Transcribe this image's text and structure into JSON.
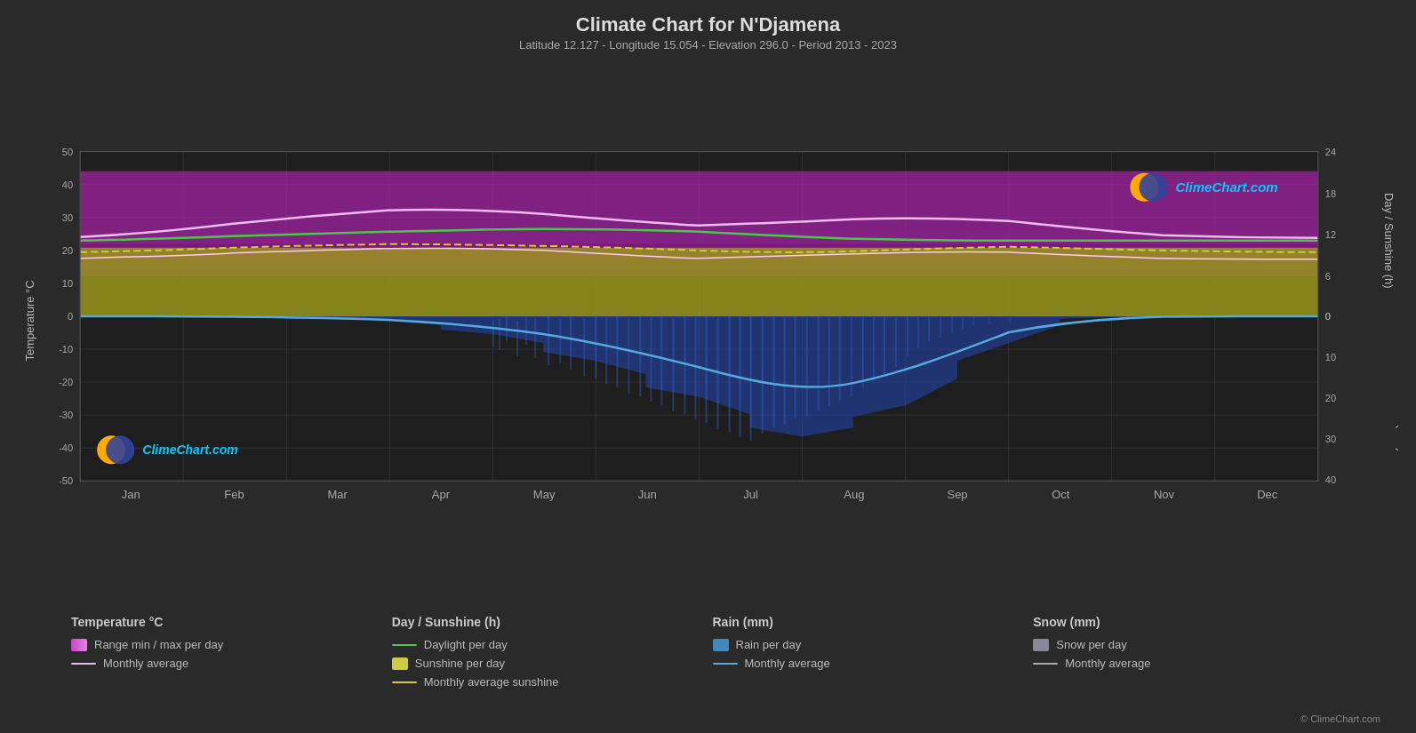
{
  "title": "Climate Chart for N'Djamena",
  "subtitle": "Latitude 12.127 - Longitude 15.054 - Elevation 296.0 - Period 2013 - 2023",
  "logo_text": "ClimeChart.com",
  "copyright": "© ClimeChart.com",
  "legend": {
    "col1": {
      "title": "Temperature °C",
      "items": [
        {
          "type": "swatch",
          "color": "#cc44cc",
          "label": "Range min / max per day"
        },
        {
          "type": "line",
          "color": "#dd88dd",
          "label": "Monthly average"
        }
      ]
    },
    "col2": {
      "title": "Day / Sunshine (h)",
      "items": [
        {
          "type": "line",
          "color": "#44cc44",
          "label": "Daylight per day"
        },
        {
          "type": "swatch",
          "color": "#cccc44",
          "label": "Sunshine per day"
        },
        {
          "type": "line",
          "color": "#cccc44",
          "label": "Monthly average sunshine"
        }
      ]
    },
    "col3": {
      "title": "Rain (mm)",
      "items": [
        {
          "type": "swatch",
          "color": "#4488bb",
          "label": "Rain per day"
        },
        {
          "type": "line",
          "color": "#55aadd",
          "label": "Monthly average"
        }
      ]
    },
    "col4": {
      "title": "Snow (mm)",
      "items": [
        {
          "type": "swatch",
          "color": "#888899",
          "label": "Snow per day"
        },
        {
          "type": "line",
          "color": "#aaaaaa",
          "label": "Monthly average"
        }
      ]
    }
  },
  "x_labels": [
    "Jan",
    "Feb",
    "Mar",
    "Apr",
    "May",
    "Jun",
    "Jul",
    "Aug",
    "Sep",
    "Oct",
    "Nov",
    "Dec"
  ],
  "y_left_labels": [
    "50",
    "40",
    "30",
    "20",
    "10",
    "0",
    "-10",
    "-20",
    "-30",
    "-40",
    "-50"
  ],
  "y_right_temp_labels": [
    "24",
    "18",
    "12",
    "6",
    "0"
  ],
  "y_right_rain_labels": [
    "0",
    "10",
    "20",
    "30",
    "40"
  ]
}
